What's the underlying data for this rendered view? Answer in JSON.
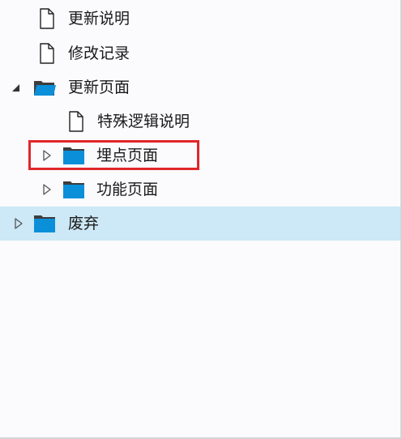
{
  "tree": {
    "items": [
      {
        "label": "更新说明",
        "type": "file"
      },
      {
        "label": "修改记录",
        "type": "file"
      },
      {
        "label": "更新页面",
        "type": "folder",
        "state": "expanded"
      },
      {
        "label": "特殊逻辑说明",
        "type": "file"
      },
      {
        "label": "埋点页面",
        "type": "folder",
        "state": "collapsed"
      },
      {
        "label": "功能页面",
        "type": "folder",
        "state": "collapsed"
      },
      {
        "label": "废弃",
        "type": "folder",
        "state": "collapsed",
        "selected": true
      }
    ]
  },
  "colors": {
    "folder": "#0b8fd9",
    "selection": "#cde8f6",
    "highlight_border": "#e0262a"
  },
  "icons": {
    "file": "file-icon",
    "folder": "folder-icon",
    "expanded": "triangle-expanded-icon",
    "collapsed": "chevron-right-icon"
  }
}
